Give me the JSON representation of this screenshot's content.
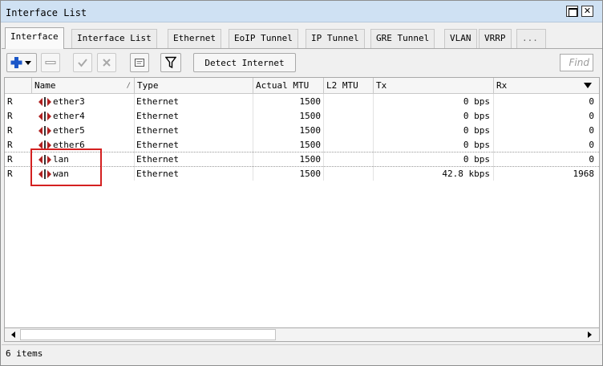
{
  "window": {
    "title": "Interface List"
  },
  "tabs": [
    "Interface",
    "Interface List",
    "Ethernet",
    "EoIP Tunnel",
    "IP Tunnel",
    "GRE Tunnel",
    "VLAN",
    "VRRP",
    "..."
  ],
  "active_tab": "Interface",
  "toolbar": {
    "add_icon": "plus-with-dropdown-icon",
    "remove_icon": "minus-icon",
    "enable_icon": "checkmark-icon",
    "disable_icon": "x-mark-icon",
    "comment_icon": "note-icon",
    "filter_icon": "funnel-icon",
    "detect_label": "Detect Internet",
    "find_placeholder": "Find"
  },
  "columns": {
    "name": "Name",
    "type": "Type",
    "mtu": "Actual MTU",
    "l2mtu": "L2 MTU",
    "tx": "Tx",
    "rx": "Rx"
  },
  "rows": [
    {
      "flag": "R",
      "name": "ether3",
      "type": "Ethernet",
      "mtu": "1500",
      "l2mtu": "",
      "tx": "0 bps",
      "rx": "0"
    },
    {
      "flag": "R",
      "name": "ether4",
      "type": "Ethernet",
      "mtu": "1500",
      "l2mtu": "",
      "tx": "0 bps",
      "rx": "0"
    },
    {
      "flag": "R",
      "name": "ether5",
      "type": "Ethernet",
      "mtu": "1500",
      "l2mtu": "",
      "tx": "0 bps",
      "rx": "0"
    },
    {
      "flag": "R",
      "name": "ether6",
      "type": "Ethernet",
      "mtu": "1500",
      "l2mtu": "",
      "tx": "0 bps",
      "rx": "0"
    },
    {
      "flag": "R",
      "name": "lan",
      "type": "Ethernet",
      "mtu": "1500",
      "l2mtu": "",
      "tx": "0 bps",
      "rx": "0"
    },
    {
      "flag": "R",
      "name": "wan",
      "type": "Ethernet",
      "mtu": "1500",
      "l2mtu": "",
      "tx": "42.8 kbps",
      "rx": "1968"
    }
  ],
  "status": {
    "count": "6 items"
  },
  "colors": {
    "title_bg": "#cfe1f3",
    "add_blue": "#1a56c8",
    "highlight_red": "#d42020",
    "iface_icon_red": "#b02020"
  }
}
